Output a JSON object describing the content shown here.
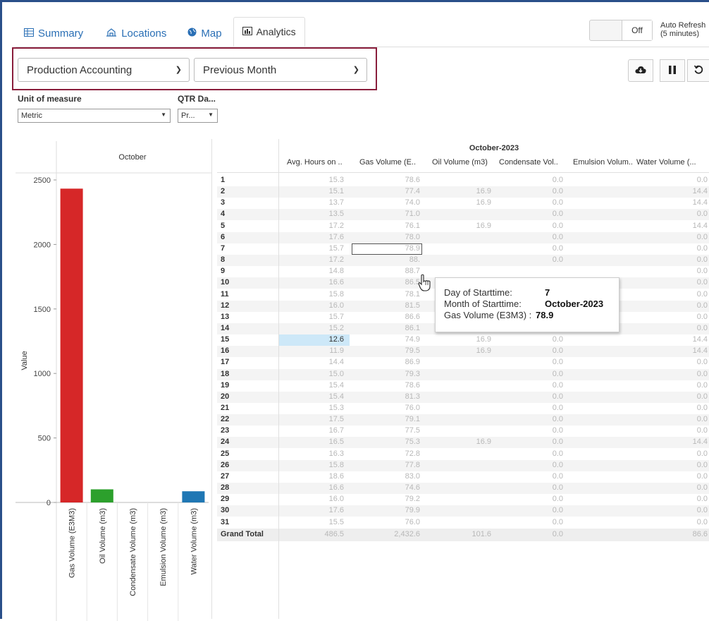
{
  "tabs": [
    {
      "label": "Summary",
      "icon": "table-icon"
    },
    {
      "label": "Locations",
      "icon": "building-icon"
    },
    {
      "label": "Map",
      "icon": "globe-icon"
    },
    {
      "label": "Analytics",
      "icon": "bar-chart-icon",
      "active": true
    }
  ],
  "toggle": {
    "state": "Off"
  },
  "auto_refresh": {
    "line1": "Auto Refresh",
    "line2": "(5 minutes)"
  },
  "filters": {
    "report": "Production Accounting",
    "period": "Previous Month"
  },
  "toolbar": {
    "download": "cloud-download-icon",
    "pause": "pause-icon",
    "refresh": "refresh-icon"
  },
  "params": {
    "unit_label": "Unit of measure",
    "unit_value": "Metric",
    "qtr_label": "QTR Da...",
    "qtr_value": "Pr..."
  },
  "chart_data": {
    "type": "bar",
    "title": "October",
    "ylabel": "Value",
    "ylim": [
      0,
      2500
    ],
    "yticks": [
      "0",
      "500",
      "1000",
      "1500",
      "2000",
      "2500"
    ],
    "categories": [
      "Gas Volume (E3M3)",
      "Oil Volume (m3)",
      "Condensate Volume (m3)",
      "Emulsion Volume (m3)",
      "Water Volume (m3)"
    ],
    "values": [
      2432.6,
      101.6,
      0,
      0,
      86.6
    ],
    "colors": [
      "#d62728",
      "#2ca02c",
      "#9467bd",
      "#8c564b",
      "#1f77b4"
    ]
  },
  "table": {
    "month": "October-2023",
    "columns": [
      "Avg. Hours on ..",
      "Gas Volume (E..",
      "Oil Volume (m3)",
      "Condensate Vol..",
      "Emulsion Volum..",
      "Water Volume (..."
    ],
    "rows": [
      {
        "day": "1",
        "hours": "15.3",
        "gas": "78.6",
        "oil": "",
        "cond": "0.0",
        "water": "0.0"
      },
      {
        "day": "2",
        "hours": "15.1",
        "gas": "77.4",
        "oil": "16.9",
        "cond": "0.0",
        "water": "14.4"
      },
      {
        "day": "3",
        "hours": "13.7",
        "gas": "74.0",
        "oil": "16.9",
        "cond": "0.0",
        "water": "14.4"
      },
      {
        "day": "4",
        "hours": "13.5",
        "gas": "71.0",
        "oil": "",
        "cond": "0.0",
        "water": "0.0"
      },
      {
        "day": "5",
        "hours": "17.2",
        "gas": "76.1",
        "oil": "16.9",
        "cond": "0.0",
        "water": "14.4"
      },
      {
        "day": "6",
        "hours": "17.6",
        "gas": "78.0",
        "oil": "",
        "cond": "0.0",
        "water": "0.0"
      },
      {
        "day": "7",
        "hours": "15.7",
        "gas": "78.9",
        "oil": "",
        "cond": "0.0",
        "water": "0.0"
      },
      {
        "day": "8",
        "hours": "17.2",
        "gas": "88.",
        "oil": "",
        "cond": "0.0",
        "water": "0.0"
      },
      {
        "day": "9",
        "hours": "14.8",
        "gas": "88.7",
        "oil": "",
        "cond": "",
        "water": "0.0"
      },
      {
        "day": "10",
        "hours": "16.6",
        "gas": "86.5",
        "oil": "",
        "cond": "",
        "water": "0.0"
      },
      {
        "day": "11",
        "hours": "15.8",
        "gas": "78.1",
        "oil": "",
        "cond": "",
        "water": "0.0"
      },
      {
        "day": "12",
        "hours": "16.0",
        "gas": "81.5",
        "oil": "",
        "cond": "",
        "water": "0.0"
      },
      {
        "day": "13",
        "hours": "15.7",
        "gas": "86.6",
        "oil": "",
        "cond": "0.0",
        "water": "0.0"
      },
      {
        "day": "14",
        "hours": "15.2",
        "gas": "86.1",
        "oil": "",
        "cond": "0.0",
        "water": "0.0"
      },
      {
        "day": "15",
        "hours": "12.6",
        "gas": "74.9",
        "oil": "16.9",
        "cond": "0.0",
        "water": "14.4"
      },
      {
        "day": "16",
        "hours": "11.9",
        "gas": "79.5",
        "oil": "16.9",
        "cond": "0.0",
        "water": "14.4"
      },
      {
        "day": "17",
        "hours": "14.4",
        "gas": "86.9",
        "oil": "",
        "cond": "0.0",
        "water": "0.0"
      },
      {
        "day": "18",
        "hours": "15.0",
        "gas": "79.3",
        "oil": "",
        "cond": "0.0",
        "water": "0.0"
      },
      {
        "day": "19",
        "hours": "15.4",
        "gas": "78.6",
        "oil": "",
        "cond": "0.0",
        "water": "0.0"
      },
      {
        "day": "20",
        "hours": "15.4",
        "gas": "81.3",
        "oil": "",
        "cond": "0.0",
        "water": "0.0"
      },
      {
        "day": "21",
        "hours": "15.3",
        "gas": "76.0",
        "oil": "",
        "cond": "0.0",
        "water": "0.0"
      },
      {
        "day": "22",
        "hours": "17.5",
        "gas": "79.1",
        "oil": "",
        "cond": "0.0",
        "water": "0.0"
      },
      {
        "day": "23",
        "hours": "16.7",
        "gas": "77.5",
        "oil": "",
        "cond": "0.0",
        "water": "0.0"
      },
      {
        "day": "24",
        "hours": "16.5",
        "gas": "75.3",
        "oil": "16.9",
        "cond": "0.0",
        "water": "14.4"
      },
      {
        "day": "25",
        "hours": "16.3",
        "gas": "72.8",
        "oil": "",
        "cond": "0.0",
        "water": "0.0"
      },
      {
        "day": "26",
        "hours": "15.8",
        "gas": "77.8",
        "oil": "",
        "cond": "0.0",
        "water": "0.0"
      },
      {
        "day": "27",
        "hours": "18.6",
        "gas": "83.0",
        "oil": "",
        "cond": "0.0",
        "water": "0.0"
      },
      {
        "day": "28",
        "hours": "16.6",
        "gas": "74.6",
        "oil": "",
        "cond": "0.0",
        "water": "0.0"
      },
      {
        "day": "29",
        "hours": "16.0",
        "gas": "79.2",
        "oil": "",
        "cond": "0.0",
        "water": "0.0"
      },
      {
        "day": "30",
        "hours": "17.6",
        "gas": "79.9",
        "oil": "",
        "cond": "0.0",
        "water": "0.0"
      },
      {
        "day": "31",
        "hours": "15.5",
        "gas": "76.0",
        "oil": "",
        "cond": "0.0",
        "water": "0.0"
      }
    ],
    "grand_total": {
      "label": "Grand Total",
      "hours": "486.5",
      "gas": "2,432.6",
      "oil": "101.6",
      "cond": "0.0",
      "water": "86.6"
    }
  },
  "tooltip": {
    "k1": "Day of Starttime:",
    "v1": "7",
    "k2": "Month of Starttime:",
    "v2": "October-2023",
    "k3": "Gas Volume (E3M3) :",
    "v3": "78.9"
  }
}
